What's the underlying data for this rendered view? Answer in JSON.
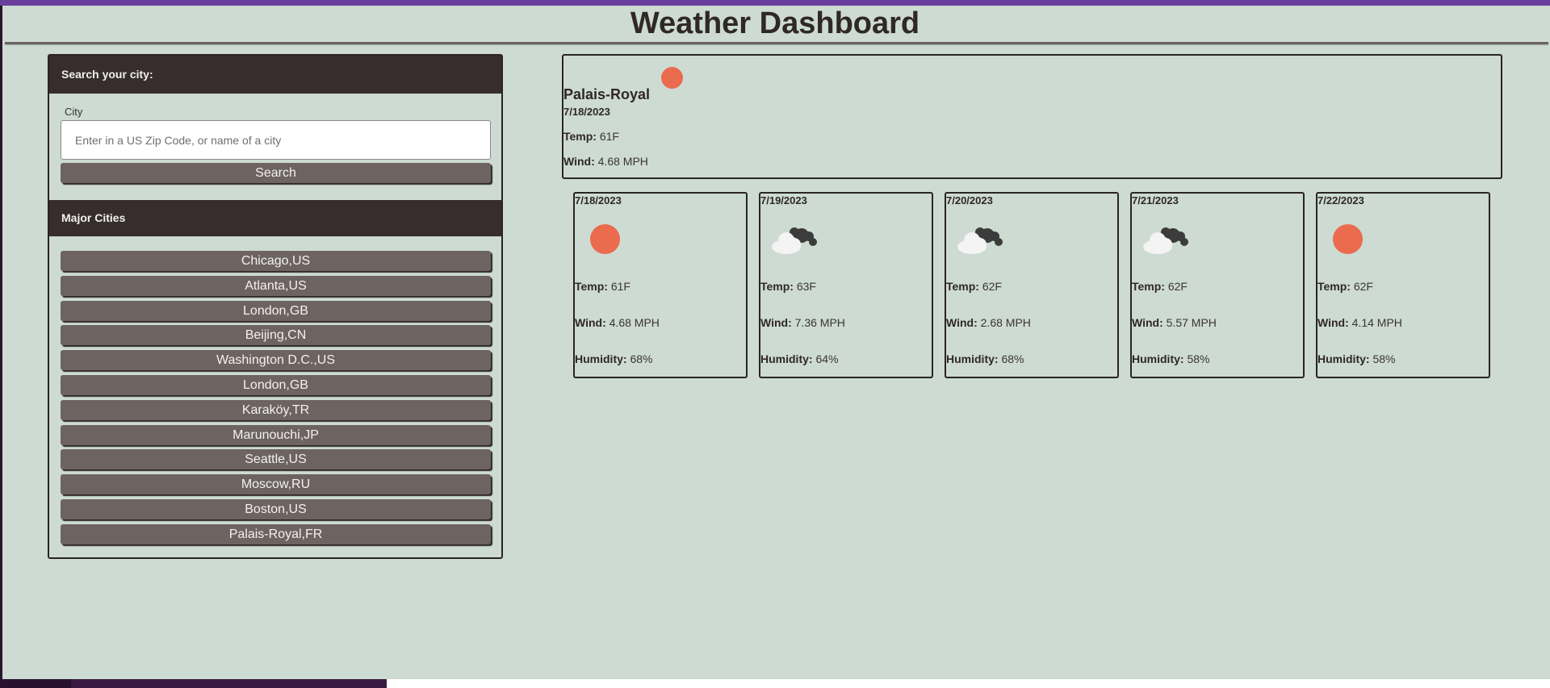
{
  "header": {
    "title": "Weather Dashboard"
  },
  "search": {
    "heading": "Search your city:",
    "label": "City",
    "placeholder": "Enter in a US Zip Code, or name of a city",
    "button_label": "Search"
  },
  "major_cities": {
    "heading": "Major Cities",
    "items": [
      "Chicago,US",
      "Atlanta,US",
      "London,GB",
      "Beijing,CN",
      "Washington D.C.,US",
      "London,GB",
      "Karaköy,TR",
      "Marunouchi,JP",
      "Seattle,US",
      "Moscow,RU",
      "Boston,US",
      "Palais-Royal,FR"
    ]
  },
  "labels": {
    "temp": "Temp:",
    "wind": "Wind:",
    "humidity": "Humidity:"
  },
  "current": {
    "city": "Palais-Royal",
    "date": "7/18/2023",
    "icon": "sun-icon",
    "temp": "61F",
    "wind": "4.68 MPH"
  },
  "forecast": [
    {
      "date": "7/18/2023",
      "icon": "sun-icon",
      "temp": "61F",
      "wind": "4.68 MPH",
      "humidity": "68%"
    },
    {
      "date": "7/19/2023",
      "icon": "cloud-icon",
      "temp": "63F",
      "wind": "7.36 MPH",
      "humidity": "64%"
    },
    {
      "date": "7/20/2023",
      "icon": "cloud-icon",
      "temp": "62F",
      "wind": "2.68 MPH",
      "humidity": "68%"
    },
    {
      "date": "7/21/2023",
      "icon": "cloud-icon",
      "temp": "62F",
      "wind": "5.57 MPH",
      "humidity": "58%"
    },
    {
      "date": "7/22/2023",
      "icon": "sun-icon",
      "temp": "62F",
      "wind": "4.14 MPH",
      "humidity": "58%"
    }
  ],
  "colors": {
    "background": "#cddbd2",
    "panel_header": "#372d2d",
    "button": "#6d6361",
    "sun": "#ea6b4e",
    "accent_stripe": "#6a3f9c"
  }
}
